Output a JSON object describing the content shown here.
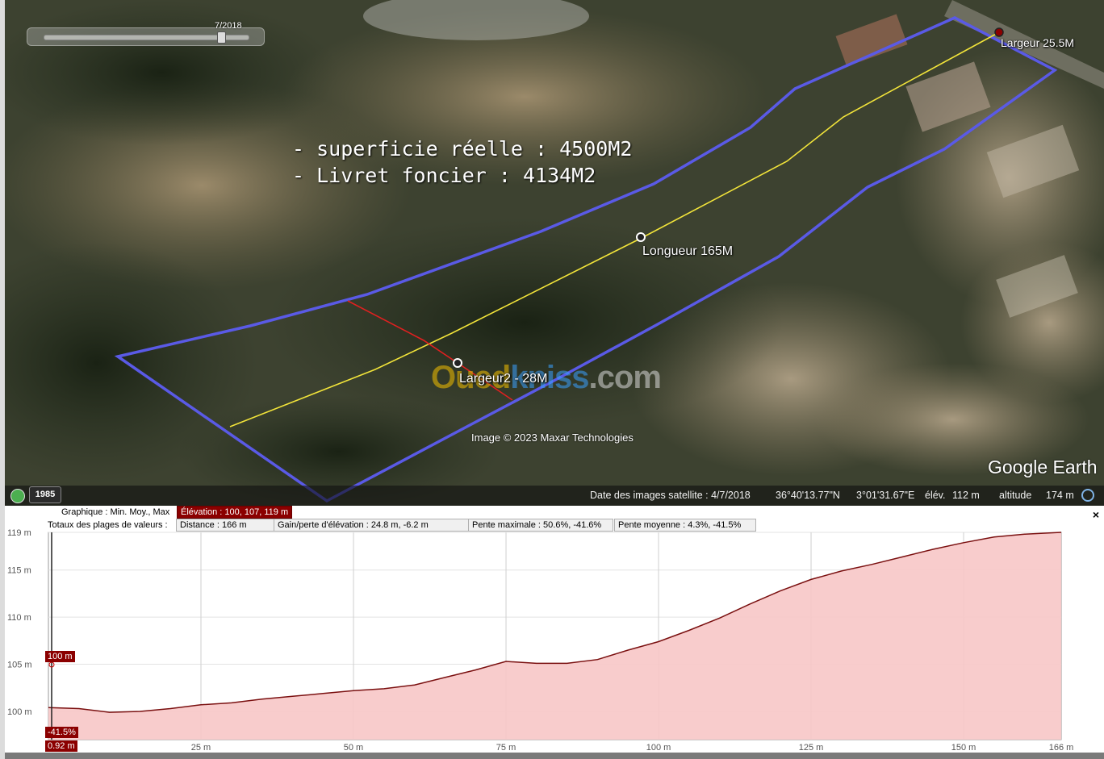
{
  "map": {
    "annotation_lines": [
      "- superficie réelle : 4500M2",
      "- Livret foncier : 4134M2"
    ],
    "labels": {
      "largeur1": "Largeur 25.5M",
      "longueur": "Longueur 165M",
      "largeur2": "Largeur2 - 28M"
    },
    "copyright": "Image © 2023 Maxar Technologies",
    "watermark": {
      "part1": "Oued",
      "part2": "kniss",
      "part3": ".com"
    },
    "logo": "Google Earth",
    "slider_label": "7/2018",
    "historical_year": "1985",
    "colors": {
      "boundary": "#5a5ae6",
      "length_line": "#f2e43a",
      "width_line": "#e02020"
    }
  },
  "statusbar": {
    "imagery_date": "Date des images satellite : 4/7/2018",
    "lat": "36°40'13.77\"N",
    "lon": "3°01'31.67\"E",
    "elev_label": "élév.",
    "elev_value": "112 m",
    "alt_label": "altitude",
    "alt_value": "174 m"
  },
  "profile": {
    "graph_label": "Graphique : Min. Moy., Max",
    "elevation": "Élévation : 100, 107, 119 m",
    "totals_label": "Totaux des plages de valeurs :",
    "distance": "Distance : 166 m",
    "gain_loss": "Gain/perte d'élévation : 24.8 m, -6.2 m",
    "max_slope": "Pente maximale : 50.6%, -41.6%",
    "avg_slope": "Pente moyenne : 4.3%, -41.5%",
    "cursor_elevation": "100 m",
    "cursor_slope": "-41.5%",
    "cursor_distance": "0.92 m",
    "close": "×"
  },
  "chart_data": {
    "type": "area",
    "title": "",
    "xlabel": "",
    "ylabel": "",
    "x_tick_labels": [
      "25 m",
      "50 m",
      "75 m",
      "100 m",
      "125 m",
      "150 m",
      "166 m"
    ],
    "y_tick_labels": [
      "100 m",
      "105 m",
      "110 m",
      "115 m",
      "119 m"
    ],
    "xlim": [
      0,
      166
    ],
    "ylim": [
      97,
      119
    ],
    "grid": true,
    "fill_color": "#f7c6c6",
    "line_color": "#7a1010",
    "x": [
      0,
      5,
      10,
      15,
      20,
      25,
      30,
      35,
      40,
      45,
      50,
      55,
      60,
      65,
      70,
      75,
      80,
      85,
      90,
      95,
      100,
      105,
      110,
      115,
      120,
      125,
      130,
      135,
      140,
      145,
      150,
      155,
      160,
      166
    ],
    "y": [
      100.4,
      100.3,
      99.9,
      100.0,
      100.3,
      100.7,
      100.9,
      101.3,
      101.6,
      101.9,
      102.2,
      102.4,
      102.8,
      103.6,
      104.4,
      105.3,
      105.1,
      105.1,
      105.5,
      106.5,
      107.4,
      108.6,
      109.9,
      111.4,
      112.8,
      114.0,
      114.9,
      115.6,
      116.4,
      117.2,
      117.9,
      118.5,
      118.8,
      119.0
    ]
  }
}
